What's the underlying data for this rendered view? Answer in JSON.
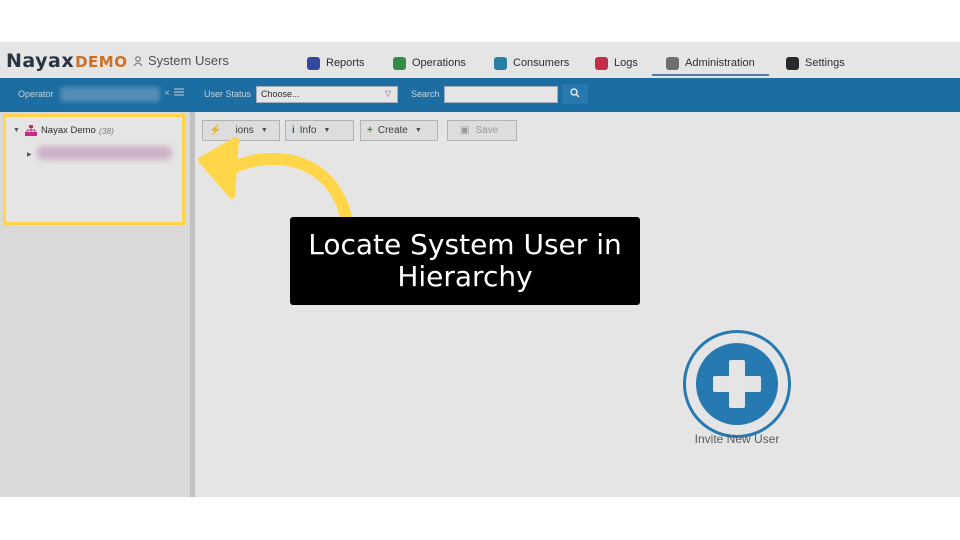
{
  "header": {
    "logo_main": "Nayax",
    "logo_suffix": "DEMO",
    "section_title": "System Users",
    "tabs": [
      {
        "label": "Reports",
        "icon": "reports-icon",
        "color": "#3a4fb0"
      },
      {
        "label": "Operations",
        "icon": "operations-icon",
        "color": "#3d9a4e"
      },
      {
        "label": "Consumers",
        "icon": "consumers-icon",
        "color": "#2f8fb5"
      },
      {
        "label": "Logs",
        "icon": "logs-icon",
        "color": "#d93451"
      },
      {
        "label": "Administration",
        "icon": "administration-icon",
        "color": "#7b7b7b"
      },
      {
        "label": "Settings",
        "icon": "settings-icon",
        "color": "#2f2f2f"
      }
    ]
  },
  "filterbar": {
    "operator_label": "Operator",
    "clear_symbol": "×",
    "user_status_label": "User Status",
    "user_status_value": "Choose...",
    "search_label": "Search",
    "search_value": "",
    "bar_color": "#1f7ab5"
  },
  "tree": {
    "root_label": "Nayax Demo",
    "root_count": "(38)"
  },
  "toolbar": {
    "actions_label": "ions",
    "info_label": "Info",
    "create_label": "Create",
    "save_label": "Save"
  },
  "invite": {
    "label": "Invite New User"
  },
  "overlay": {
    "callout_text": "Locate System User in Hierarchy",
    "highlight_color": "#ffd54a"
  }
}
